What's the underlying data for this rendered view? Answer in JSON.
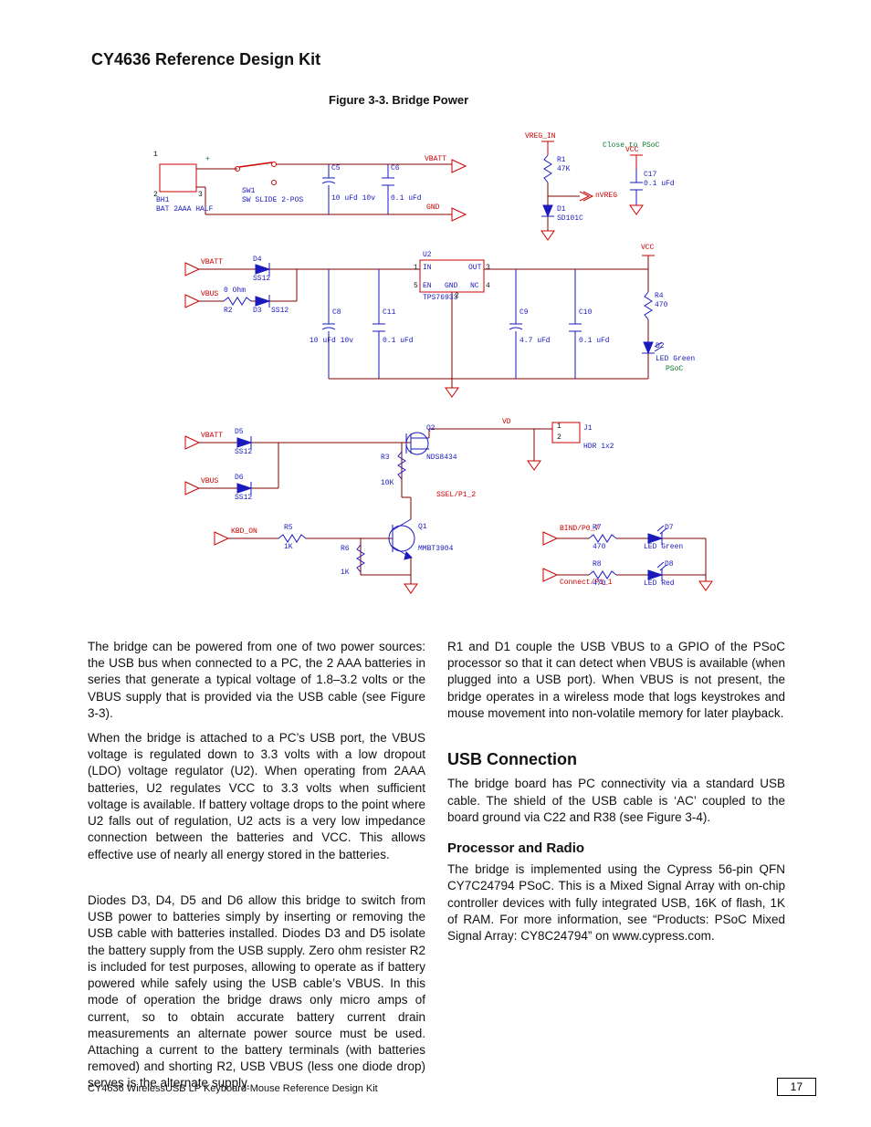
{
  "page": {
    "title": "CY4636 Reference Design Kit",
    "figure_title": "Figure 3-3. Bridge Power",
    "footer": "CY4636 WirelessUSB LP Keyboard-Mouse Reference Design Kit",
    "page_number": "17"
  },
  "schematic": {
    "note_close_to_psoc": "Close to PSoC",
    "note_psoc": "PSoC",
    "batt": {
      "ref": "BH1",
      "part": "BAT 2AAA HALF",
      "tp1": "1",
      "tp2": "2",
      "tp3": "3"
    },
    "sw1": {
      "ref": "SW1",
      "part": "SW SLIDE 2-POS"
    },
    "net_vbatt": "VBATT",
    "net_vbatt_flag": "VBATT",
    "net_gnd": "GND",
    "c5": {
      "ref": "C5",
      "part": "10 uFd 10v"
    },
    "c6": {
      "ref": "C6",
      "part": "0.1 uFd"
    },
    "r1": {
      "ref": "R1",
      "part": "47K"
    },
    "d1": {
      "ref": "D1",
      "part": "SD101C"
    },
    "net_nvreg": "nVREG",
    "net_vreg_in": "VREG_IN",
    "c17": {
      "ref": "C17",
      "part": "0.1 uFd"
    },
    "net_vcc_top": "VCC",
    "d4": {
      "ref": "D4",
      "part": "SS12"
    },
    "d3": {
      "ref": "D3",
      "part": "SS12"
    },
    "r2": {
      "ref": "R2",
      "part": "0 Ohm"
    },
    "net_vbatt_in": "VBATT",
    "net_vbus_in": "VBUS",
    "u2": {
      "ref": "U2",
      "part": "TPS76933",
      "p1": "IN",
      "p1n": "1",
      "p2": "OUT",
      "p2n": "3",
      "p3": "GND",
      "p3n": "2",
      "p4": "EN",
      "p4n": "5",
      "p5": "NC",
      "p5n": "4"
    },
    "c8": {
      "ref": "C8",
      "part": "10 uFd 10v"
    },
    "c11": {
      "ref": "C11",
      "part": "0.1 uFd"
    },
    "c9": {
      "ref": "C9",
      "part": "4.7 uFd"
    },
    "c10": {
      "ref": "C10",
      "part": "0.1 uFd"
    },
    "r4": {
      "ref": "R4",
      "part": "470"
    },
    "d2": {
      "ref": "D2",
      "part": "LED Green"
    },
    "net_vcc_out": "VCC",
    "d5": {
      "ref": "D5",
      "part": "SS12"
    },
    "d6": {
      "ref": "D6",
      "part": "SS12"
    },
    "net_vbatt2": "VBATT",
    "net_vbus2": "VBUS",
    "q2": {
      "ref": "Q2",
      "part": "NDS8434"
    },
    "r3": {
      "ref": "R3",
      "part": "10K"
    },
    "j1": {
      "ref": "J1",
      "part": "HDR 1x2",
      "p1": "1",
      "p2": "2"
    },
    "net_vd": "VD",
    "q1": {
      "ref": "Q1",
      "part": "MMBT3904"
    },
    "r5": {
      "ref": "R5",
      "part": "1K"
    },
    "r6": {
      "ref": "R6",
      "part": "1K"
    },
    "net_kbd_on": "KBD_ON",
    "net_ssel_p12": "SSEL/P1_2",
    "r7": {
      "ref": "R7",
      "part": "470"
    },
    "r8": {
      "ref": "R8",
      "part": "470"
    },
    "d7": {
      "ref": "D7",
      "part": "LED Green"
    },
    "d8": {
      "ref": "D8",
      "part": "LED Red"
    },
    "net_bind": "BIND/P0_7",
    "net_connect": "Connect/P1_1"
  },
  "text": {
    "para1": "The bridge can be powered from one of two power sources: the USB bus when connected to a PC, the 2 AAA batteries in series that generate a typical voltage of 1.8–3.2 volts or the VBUS supply that is provided via the USB cable (see Figure 3-3).",
    "para2": "When the bridge is attached to a PC’s USB port, the VBUS voltage is regulated down to 3.3 volts with a low dropout (LDO) voltage regulator (U2). When operating from 2AAA batteries, U2 regulates VCC to 3.3 volts when sufficient voltage is available. If battery voltage drops to the point where U2 falls out of regulation, U2 acts is a very low impedance connection between the batteries and VCC. This allows effective use of nearly all energy stored in the batteries.",
    "para3": "Diodes D3, D4, D5 and D6 allow this bridge to switch from USB power to batteries simply by inserting or removing the USB cable with batteries installed. Diodes D3 and D5 isolate the battery supply from the USB supply. Zero ohm resister R2 is included for test purposes, allowing to operate as if battery powered while safely using the USB cable’s VBUS. In this mode of operation the bridge draws only micro amps of current, so to obtain accurate battery current drain measurements an alternate power source must be used. Attaching a current to the battery terminals (with batteries removed) and shorting R2, USB VBUS (less one diode drop) serves is the alternate supply.",
    "para4": "R1 and D1 couple the USB VBUS to a GPIO of the PSoC processor so that it can detect when VBUS is available (when plugged into a USB port). When VBUS is not present, the bridge operates in a wireless mode that logs keystrokes and mouse movement into non-volatile memory for later playback.",
    "usb_head": "USB Connection",
    "usb_para": "The bridge board has PC connectivity via a standard USB cable. The shield of the USB cable is ‘AC’ coupled to the board ground via C22 and R38 (see Figure 3-4).",
    "proc_head": "Processor and Radio",
    "proc_para_a": "The bridge is implemented using the Cypress 56-pin QFN CY7C24794 PSoC. This is a Mixed Signal Array with on-chip controller devices with fully integrated USB, 16K of flash, 1K of RAM. For more information, see ",
    "proc_para_b": "“Products: PSoC Mixed Signal Array: CY8C24794”",
    "proc_para_c": " on www.cypress.com."
  }
}
